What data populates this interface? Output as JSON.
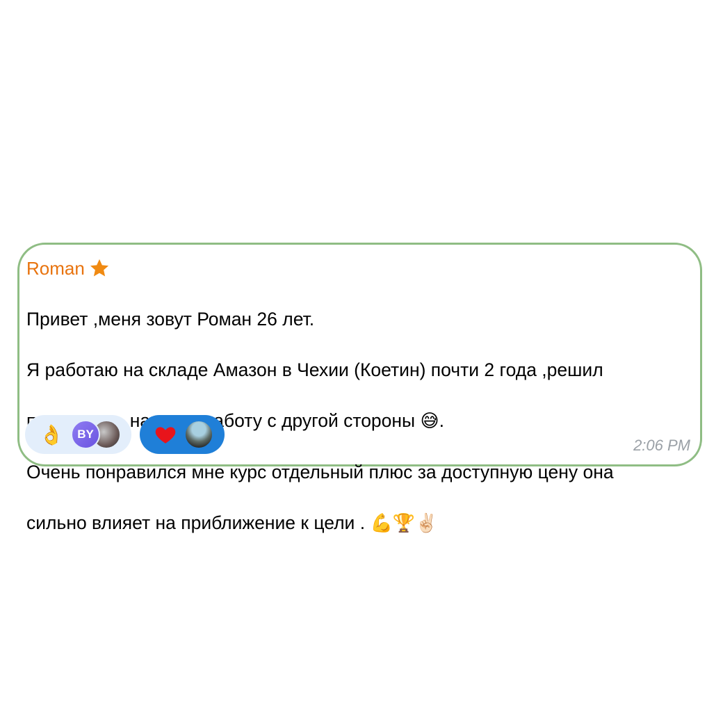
{
  "message": {
    "sender_name": "Roman",
    "sender_badge_icon": "star-icon",
    "text_lines": [
      "Привет ,меня зовут Роман 26 лет.",
      "Я работаю на складе Амазон в Чехии (Коетин) почти 2 года ,решил",
      "посмотреть на свою работу с другой стороны ",
      "Очень понравился мне курс отдельный плюс за доступную цену она",
      "сильно влияет на приближение к цели . "
    ],
    "line3_emoji": "😅",
    "line3_end": ".",
    "line5_emojis": "💪🏆✌🏻",
    "time": "2:06 PM"
  },
  "reactions": [
    {
      "emoji": "👌",
      "avatar_initials": "BY"
    },
    {
      "emoji": "❤️"
    }
  ],
  "colors": {
    "sender": "#e8730e",
    "border": "#8fbd84",
    "reaction_light": "#e3eefb",
    "reaction_active": "#1f7fd8",
    "timestamp": "#9aa0a6"
  }
}
